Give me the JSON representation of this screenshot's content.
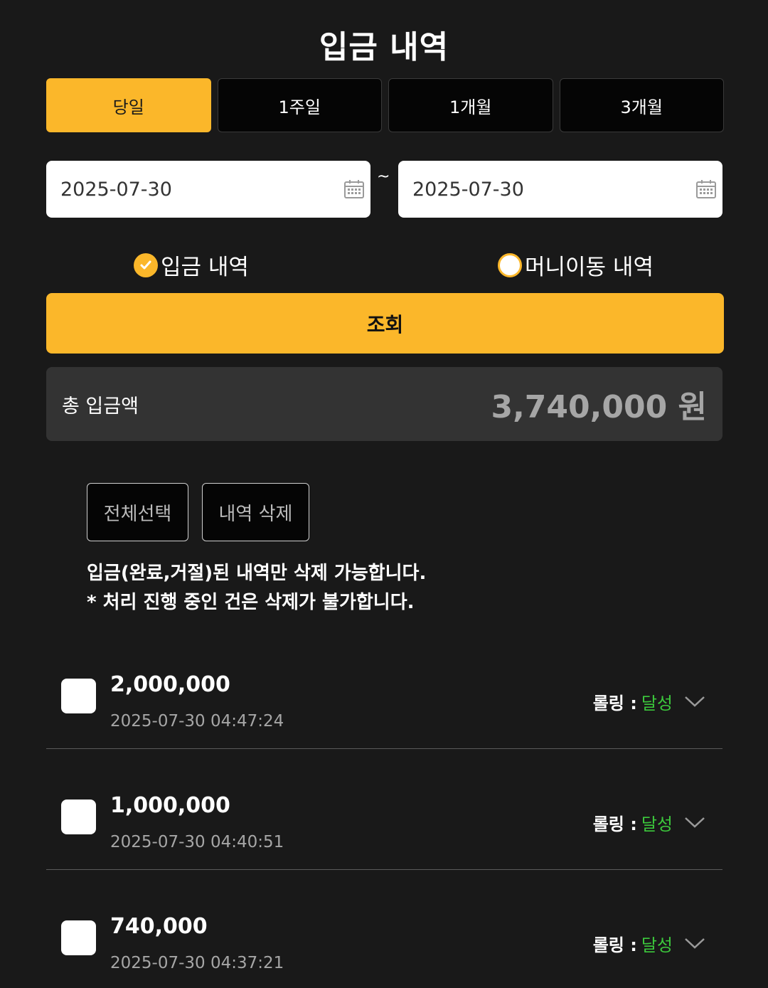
{
  "page": {
    "title": "입금 내역"
  },
  "tabs": [
    {
      "label": "당일",
      "active": true
    },
    {
      "label": "1주일",
      "active": false
    },
    {
      "label": "1개월",
      "active": false
    },
    {
      "label": "3개월",
      "active": false
    }
  ],
  "dates": {
    "from": "2025-07-30",
    "to": "2025-07-30",
    "separator": "~",
    "icon": "calendar-icon"
  },
  "filters": [
    {
      "label": "입금 내역",
      "checked": true
    },
    {
      "label": "머니이동 내역",
      "checked": false
    }
  ],
  "search": {
    "label": "조회"
  },
  "total": {
    "label": "총 입금액",
    "value": "3,740,000 원"
  },
  "actions": {
    "select_all": "전체선택",
    "delete": "내역 삭제"
  },
  "notice": {
    "line1": "입금(완료,거절)된 내역만 삭제 가능합니다.",
    "line2": "* 처리 진행 중인 건은 삭제가 불가합니다."
  },
  "colors": {
    "accent": "#fbb72a",
    "background": "#191919",
    "success": "#3cc83c"
  },
  "deposits": [
    {
      "amount": "2,000,000",
      "timestamp": "2025-07-30 04:47:24",
      "rolling_label": "롤링 :",
      "rolling_status": "달성"
    },
    {
      "amount": "1,000,000",
      "timestamp": "2025-07-30 04:40:51",
      "rolling_label": "롤링 :",
      "rolling_status": "달성"
    },
    {
      "amount": "740,000",
      "timestamp": "2025-07-30 04:37:21",
      "rolling_label": "롤링 :",
      "rolling_status": "달성"
    }
  ]
}
